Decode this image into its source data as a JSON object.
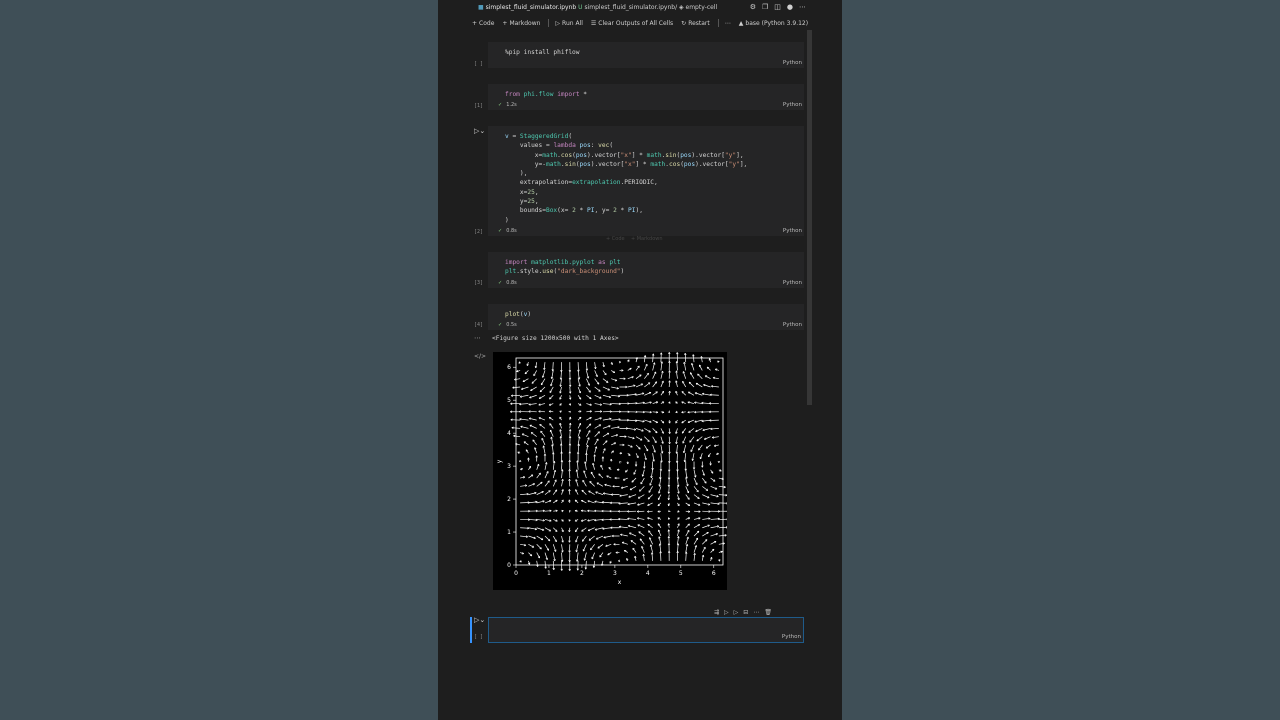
{
  "tabbar": {
    "breadcrumb_file": "simplest_fluid_simulator.ipynb",
    "modified_marker": "U",
    "breadcrumb_rest": "simplest_fluid_simulator.ipynb/ ◈ empty-cell"
  },
  "toolbar": {
    "code_label": "Code",
    "markdown_label": "Markdown",
    "run_all_label": "Run All",
    "clear_label": "Clear Outputs of All Cells",
    "restart_label": "Restart",
    "kernel_label": "base (Python 3.9.12)"
  },
  "cells": [
    {
      "gutter": "[ ]",
      "code": "%pip install phiflow",
      "lang": "Python",
      "time": ""
    },
    {
      "gutter": "[1]",
      "time": "1.2s",
      "lang": "Python"
    },
    {
      "gutter": "[2]",
      "time": "0.8s",
      "lang": "Python"
    },
    {
      "gutter": "[3]",
      "time": "0.8s",
      "lang": "Python"
    },
    {
      "gutter": "[4]",
      "time": "0.5s",
      "lang": "Python"
    },
    {
      "gutter": "[ ]",
      "lang": "Python"
    }
  ],
  "inline_hint": {
    "code": "+ Code",
    "markdown": "+ Markdown"
  },
  "output": {
    "text": "<Figure size 1200x500 with 1 Axes>"
  },
  "chart_data": {
    "type": "vector_field",
    "xlabel": "x",
    "ylabel": "y",
    "xlim": [
      0,
      6.28
    ],
    "ylim": [
      0,
      6.28
    ],
    "xticks": [
      0,
      1,
      2,
      3,
      4,
      5,
      6
    ],
    "yticks": [
      0,
      1,
      2,
      3,
      4,
      5,
      6
    ],
    "field": "x = cos(x)*sin(y), y = -sin(x)*cos(y)",
    "grid_n": 25,
    "background": "#000000",
    "arrow_color": "#ffffff"
  }
}
